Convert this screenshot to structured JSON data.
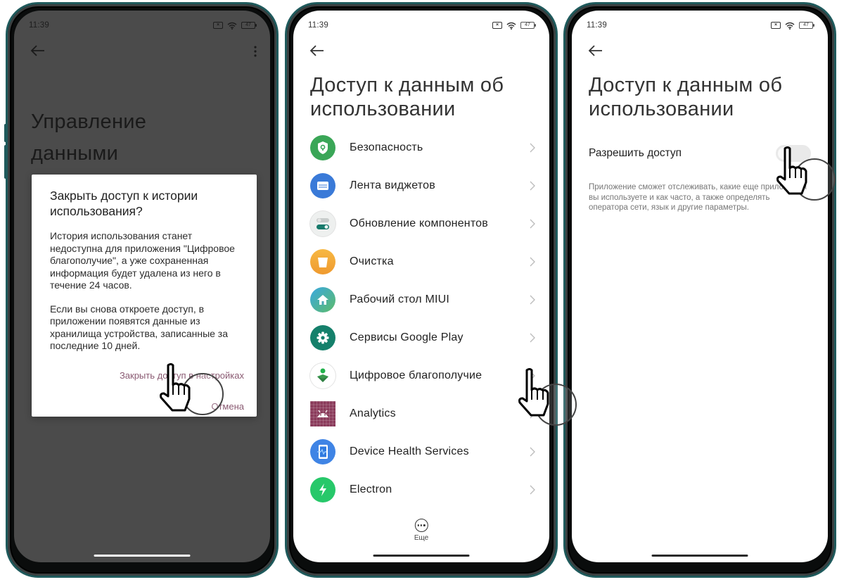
{
  "status_bar": {
    "time": "11:39",
    "battery": "47",
    "sim_icon": "sim-off-icon",
    "wifi_icon": "wifi-icon"
  },
  "screen1": {
    "page_title_line1": "Управление",
    "page_title_line2": "данными",
    "dialog": {
      "title": "Закрыть доступ к истории использования?",
      "body1": "История использования станет недоступна для приложения \"Цифровое благополучие\", а уже сохраненная информация будет удалена из него в течение 24 часов.",
      "body2": "Если вы снова откроете доступ, в приложении появятся данные из хранилища устройства, записанные за последние 10 дней.",
      "confirm_label": "Закрыть доступ в настройках",
      "cancel_label": "Отмена"
    }
  },
  "screen2": {
    "page_title": "Доступ к данным об использовании",
    "apps": [
      {
        "label": "Безопасность",
        "icon": "shield-icon",
        "color": "#3aa657"
      },
      {
        "label": "Лента виджетов",
        "icon": "widget-feed-icon",
        "color": "#3a7ad8"
      },
      {
        "label": "Обновление компонентов",
        "icon": "toggles-icon",
        "color": "#eef0ef"
      },
      {
        "label": "Очистка",
        "icon": "trash-icon",
        "color": "#f3a637"
      },
      {
        "label": "Рабочий стол MIUI",
        "icon": "home-icon",
        "color": "#3ea7c9"
      },
      {
        "label": "Сервисы Google Play",
        "icon": "gear-icon",
        "color": "#15806b"
      },
      {
        "label": "Цифровое благополучие",
        "icon": "wellbeing-icon",
        "color": "#ffffff"
      },
      {
        "label": "Analytics",
        "icon": "android-icon",
        "color": "#8a3a5a"
      },
      {
        "label": "Device Health Services",
        "icon": "device-health-icon",
        "color": "#3f84e5"
      },
      {
        "label": "Electron",
        "icon": "bolt-icon",
        "color": "#27c86a"
      }
    ],
    "more_label": "Еще"
  },
  "screen3": {
    "page_title": "Доступ к данным об использовании",
    "allow_label": "Разрешить доступ",
    "allow_enabled": false,
    "description": "Приложение сможет отслеживать, какие еще приложения вы используете и как часто, а также определять оператора сети, язык и другие параметры."
  }
}
